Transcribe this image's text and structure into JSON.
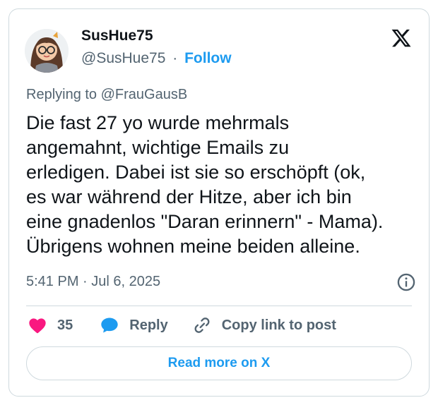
{
  "author": {
    "display_name": "SusHue75",
    "handle": "@SusHue75",
    "separator": "·",
    "follow_label": "Follow",
    "avatar_icon": "cartoon-avatar-with-glasses"
  },
  "reply_context": {
    "prefix": "Replying to ",
    "mention": "@FrauGausB"
  },
  "tweet": {
    "text_lines": [
      "Die fast 27 yo wurde mehrmals",
      "angemahnt, wichtige Emails zu",
      "erledigen. Dabei ist sie so erschöpft (ok,",
      "es war während der Hitze, aber ich bin",
      "eine gnadenlos \"Daran erinnern\" - Mama).",
      "Übrigens wohnen meine beiden alleine."
    ],
    "timestamp": "5:41 PM · Jul 6, 2025"
  },
  "actions": {
    "like_count": "35",
    "reply_label": "Reply",
    "copy_link_label": "Copy link to post"
  },
  "read_more_label": "Read more on X",
  "icons": {
    "brand": "x-logo-icon",
    "info": "info-icon",
    "like": "heart-icon",
    "reply": "speech-bubble-icon",
    "copy": "link-icon"
  },
  "colors": {
    "accent": "#1d9bf0",
    "like": "#f91880",
    "secondary_text": "#536471",
    "primary_text": "#0f1419",
    "border": "#cfd9de"
  }
}
